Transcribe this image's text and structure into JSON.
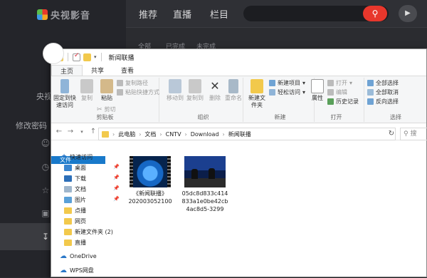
{
  "app": {
    "logo_text": "央视影音",
    "nav": [
      "推荐",
      "直播",
      "栏目"
    ],
    "search_placeholder": "",
    "subtabs": [
      "全部",
      "已完成",
      "未完成"
    ],
    "side": {
      "user_label": "央视",
      "modify_password": "修改密码"
    }
  },
  "explorer": {
    "title": "新闻联播",
    "tabs": [
      "文件",
      "主页",
      "共享",
      "查看"
    ],
    "ribbon": {
      "clipboard": {
        "pin": "固定到快速访问",
        "copy": "复制",
        "paste": "粘贴",
        "copy_path": "复制路径",
        "paste_shortcut": "粘贴快捷方式",
        "cut": "剪切",
        "label": "剪贴板"
      },
      "organize": {
        "move_to": "移动到",
        "copy_to": "复制到",
        "delete": "删除",
        "rename": "重命名",
        "label": "组织"
      },
      "new": {
        "new_folder": "新建文件夹",
        "new_item": "新建项目",
        "easy_access": "轻松访问",
        "label": "新建"
      },
      "open": {
        "properties": "属性",
        "open": "打开",
        "edit": "编辑",
        "history": "历史记录",
        "label": "打开"
      },
      "select": {
        "select_all": "全部选择",
        "select_none": "全部取消",
        "invert": "反向选择",
        "label": "选择"
      }
    },
    "address": [
      "此电脑",
      "文档",
      "CNTV",
      "Download",
      "新闻联播"
    ],
    "search_placeholder": "搜",
    "nav": {
      "quick_access": "快速访问",
      "items": [
        "桌面",
        "下载",
        "文档",
        "图片",
        "点播",
        "网页",
        "新建文件夹 (2)",
        "直播"
      ],
      "onedrive": "OneDrive",
      "wps": "WPS网盘"
    },
    "files": [
      {
        "line1": "《新闻联播》",
        "line2": "202003052100"
      },
      {
        "line1": "05dc8d833c414",
        "line2": "833a1e0be42cb",
        "line3": "4ac8d5-3299"
      }
    ]
  }
}
